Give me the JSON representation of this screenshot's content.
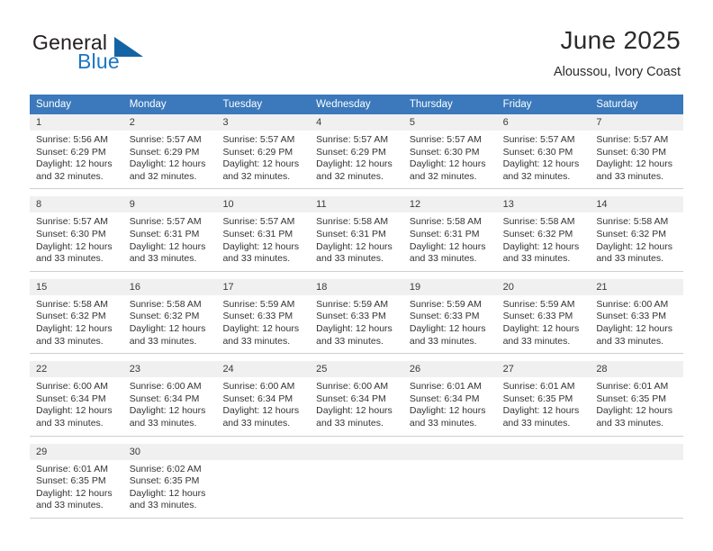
{
  "brand": {
    "word1": "General",
    "word2": "Blue",
    "triangle_color": "#1464a5",
    "blue_text_color": "#1b76c3"
  },
  "header": {
    "title": "June 2025",
    "subtitle": "Aloussou, Ivory Coast",
    "header_bg_color": "#3b79bc",
    "day_band_color": "#f0f0f0"
  },
  "weekdays": [
    "Sunday",
    "Monday",
    "Tuesday",
    "Wednesday",
    "Thursday",
    "Friday",
    "Saturday"
  ],
  "weeks": [
    [
      {
        "day": "1",
        "sunrise": "Sunrise: 5:56 AM",
        "sunset": "Sunset: 6:29 PM",
        "daylight_line1": "Daylight: 12 hours",
        "daylight_line2": "and 32 minutes."
      },
      {
        "day": "2",
        "sunrise": "Sunrise: 5:57 AM",
        "sunset": "Sunset: 6:29 PM",
        "daylight_line1": "Daylight: 12 hours",
        "daylight_line2": "and 32 minutes."
      },
      {
        "day": "3",
        "sunrise": "Sunrise: 5:57 AM",
        "sunset": "Sunset: 6:29 PM",
        "daylight_line1": "Daylight: 12 hours",
        "daylight_line2": "and 32 minutes."
      },
      {
        "day": "4",
        "sunrise": "Sunrise: 5:57 AM",
        "sunset": "Sunset: 6:29 PM",
        "daylight_line1": "Daylight: 12 hours",
        "daylight_line2": "and 32 minutes."
      },
      {
        "day": "5",
        "sunrise": "Sunrise: 5:57 AM",
        "sunset": "Sunset: 6:30 PM",
        "daylight_line1": "Daylight: 12 hours",
        "daylight_line2": "and 32 minutes."
      },
      {
        "day": "6",
        "sunrise": "Sunrise: 5:57 AM",
        "sunset": "Sunset: 6:30 PM",
        "daylight_line1": "Daylight: 12 hours",
        "daylight_line2": "and 32 minutes."
      },
      {
        "day": "7",
        "sunrise": "Sunrise: 5:57 AM",
        "sunset": "Sunset: 6:30 PM",
        "daylight_line1": "Daylight: 12 hours",
        "daylight_line2": "and 33 minutes."
      }
    ],
    [
      {
        "day": "8",
        "sunrise": "Sunrise: 5:57 AM",
        "sunset": "Sunset: 6:30 PM",
        "daylight_line1": "Daylight: 12 hours",
        "daylight_line2": "and 33 minutes."
      },
      {
        "day": "9",
        "sunrise": "Sunrise: 5:57 AM",
        "sunset": "Sunset: 6:31 PM",
        "daylight_line1": "Daylight: 12 hours",
        "daylight_line2": "and 33 minutes."
      },
      {
        "day": "10",
        "sunrise": "Sunrise: 5:57 AM",
        "sunset": "Sunset: 6:31 PM",
        "daylight_line1": "Daylight: 12 hours",
        "daylight_line2": "and 33 minutes."
      },
      {
        "day": "11",
        "sunrise": "Sunrise: 5:58 AM",
        "sunset": "Sunset: 6:31 PM",
        "daylight_line1": "Daylight: 12 hours",
        "daylight_line2": "and 33 minutes."
      },
      {
        "day": "12",
        "sunrise": "Sunrise: 5:58 AM",
        "sunset": "Sunset: 6:31 PM",
        "daylight_line1": "Daylight: 12 hours",
        "daylight_line2": "and 33 minutes."
      },
      {
        "day": "13",
        "sunrise": "Sunrise: 5:58 AM",
        "sunset": "Sunset: 6:32 PM",
        "daylight_line1": "Daylight: 12 hours",
        "daylight_line2": "and 33 minutes."
      },
      {
        "day": "14",
        "sunrise": "Sunrise: 5:58 AM",
        "sunset": "Sunset: 6:32 PM",
        "daylight_line1": "Daylight: 12 hours",
        "daylight_line2": "and 33 minutes."
      }
    ],
    [
      {
        "day": "15",
        "sunrise": "Sunrise: 5:58 AM",
        "sunset": "Sunset: 6:32 PM",
        "daylight_line1": "Daylight: 12 hours",
        "daylight_line2": "and 33 minutes."
      },
      {
        "day": "16",
        "sunrise": "Sunrise: 5:58 AM",
        "sunset": "Sunset: 6:32 PM",
        "daylight_line1": "Daylight: 12 hours",
        "daylight_line2": "and 33 minutes."
      },
      {
        "day": "17",
        "sunrise": "Sunrise: 5:59 AM",
        "sunset": "Sunset: 6:33 PM",
        "daylight_line1": "Daylight: 12 hours",
        "daylight_line2": "and 33 minutes."
      },
      {
        "day": "18",
        "sunrise": "Sunrise: 5:59 AM",
        "sunset": "Sunset: 6:33 PM",
        "daylight_line1": "Daylight: 12 hours",
        "daylight_line2": "and 33 minutes."
      },
      {
        "day": "19",
        "sunrise": "Sunrise: 5:59 AM",
        "sunset": "Sunset: 6:33 PM",
        "daylight_line1": "Daylight: 12 hours",
        "daylight_line2": "and 33 minutes."
      },
      {
        "day": "20",
        "sunrise": "Sunrise: 5:59 AM",
        "sunset": "Sunset: 6:33 PM",
        "daylight_line1": "Daylight: 12 hours",
        "daylight_line2": "and 33 minutes."
      },
      {
        "day": "21",
        "sunrise": "Sunrise: 6:00 AM",
        "sunset": "Sunset: 6:33 PM",
        "daylight_line1": "Daylight: 12 hours",
        "daylight_line2": "and 33 minutes."
      }
    ],
    [
      {
        "day": "22",
        "sunrise": "Sunrise: 6:00 AM",
        "sunset": "Sunset: 6:34 PM",
        "daylight_line1": "Daylight: 12 hours",
        "daylight_line2": "and 33 minutes."
      },
      {
        "day": "23",
        "sunrise": "Sunrise: 6:00 AM",
        "sunset": "Sunset: 6:34 PM",
        "daylight_line1": "Daylight: 12 hours",
        "daylight_line2": "and 33 minutes."
      },
      {
        "day": "24",
        "sunrise": "Sunrise: 6:00 AM",
        "sunset": "Sunset: 6:34 PM",
        "daylight_line1": "Daylight: 12 hours",
        "daylight_line2": "and 33 minutes."
      },
      {
        "day": "25",
        "sunrise": "Sunrise: 6:00 AM",
        "sunset": "Sunset: 6:34 PM",
        "daylight_line1": "Daylight: 12 hours",
        "daylight_line2": "and 33 minutes."
      },
      {
        "day": "26",
        "sunrise": "Sunrise: 6:01 AM",
        "sunset": "Sunset: 6:34 PM",
        "daylight_line1": "Daylight: 12 hours",
        "daylight_line2": "and 33 minutes."
      },
      {
        "day": "27",
        "sunrise": "Sunrise: 6:01 AM",
        "sunset": "Sunset: 6:35 PM",
        "daylight_line1": "Daylight: 12 hours",
        "daylight_line2": "and 33 minutes."
      },
      {
        "day": "28",
        "sunrise": "Sunrise: 6:01 AM",
        "sunset": "Sunset: 6:35 PM",
        "daylight_line1": "Daylight: 12 hours",
        "daylight_line2": "and 33 minutes."
      }
    ],
    [
      {
        "day": "29",
        "sunrise": "Sunrise: 6:01 AM",
        "sunset": "Sunset: 6:35 PM",
        "daylight_line1": "Daylight: 12 hours",
        "daylight_line2": "and 33 minutes."
      },
      {
        "day": "30",
        "sunrise": "Sunrise: 6:02 AM",
        "sunset": "Sunset: 6:35 PM",
        "daylight_line1": "Daylight: 12 hours",
        "daylight_line2": "and 33 minutes."
      },
      {
        "day": "",
        "sunrise": "",
        "sunset": "",
        "daylight_line1": "",
        "daylight_line2": ""
      },
      {
        "day": "",
        "sunrise": "",
        "sunset": "",
        "daylight_line1": "",
        "daylight_line2": ""
      },
      {
        "day": "",
        "sunrise": "",
        "sunset": "",
        "daylight_line1": "",
        "daylight_line2": ""
      },
      {
        "day": "",
        "sunrise": "",
        "sunset": "",
        "daylight_line1": "",
        "daylight_line2": ""
      },
      {
        "day": "",
        "sunrise": "",
        "sunset": "",
        "daylight_line1": "",
        "daylight_line2": ""
      }
    ]
  ]
}
